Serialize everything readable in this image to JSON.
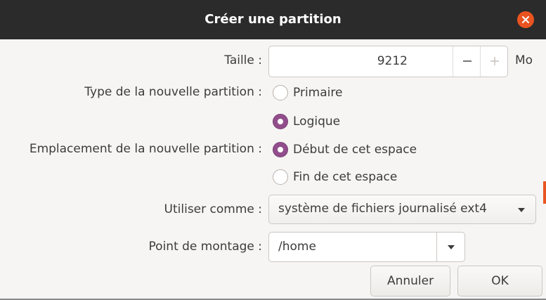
{
  "dialog": {
    "title": "Créer une partition"
  },
  "form": {
    "size": {
      "label": "Taille :",
      "value": "9212",
      "unit": "Mo",
      "decrement": "−",
      "increment": "+"
    },
    "partition_type": {
      "label": "Type de la nouvelle partition :",
      "options": [
        {
          "label": "Primaire",
          "selected": false
        },
        {
          "label": "Logique",
          "selected": true
        }
      ]
    },
    "location": {
      "label": "Emplacement de la nouvelle partition :",
      "options": [
        {
          "label": "Début de cet espace",
          "selected": true
        },
        {
          "label": "Fin de cet espace",
          "selected": false
        }
      ]
    },
    "use_as": {
      "label": "Utiliser comme :",
      "value": "système de fichiers journalisé ext4"
    },
    "mount_point": {
      "label": "Point de montage :",
      "value": "/home"
    }
  },
  "buttons": {
    "cancel": "Annuler",
    "ok": "OK"
  },
  "colors": {
    "titlebar": "#2b2b2b",
    "close": "#e95420",
    "radio_selected": "#924d8b"
  },
  "icons": {
    "close": "close-icon",
    "dropdown": "chevron-down-icon"
  }
}
